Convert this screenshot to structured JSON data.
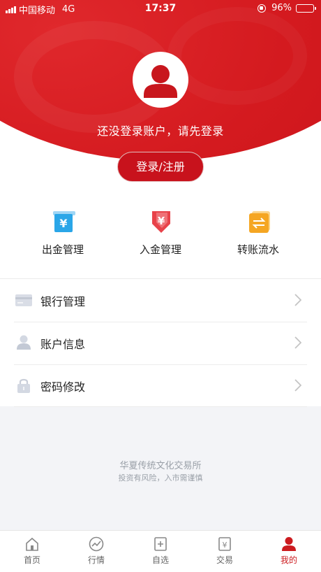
{
  "status_bar": {
    "carrier": "中国移动",
    "network": "4G",
    "time": "17:37",
    "battery_text": "96%",
    "battery_level": 0.96
  },
  "header": {
    "prompt": "还没登录账户，请先登录",
    "login_button": "登录/注册"
  },
  "quick_actions": [
    {
      "label": "出金管理",
      "icon": "withdraw-icon",
      "color": "#2aa6e8"
    },
    {
      "label": "入金管理",
      "icon": "deposit-icon",
      "color": "#e8434a"
    },
    {
      "label": "转账流水",
      "icon": "transfer-icon",
      "color": "#f5a623"
    }
  ],
  "menu": [
    {
      "label": "银行管理",
      "icon": "bank-card-icon"
    },
    {
      "label": "账户信息",
      "icon": "user-icon"
    },
    {
      "label": "密码修改",
      "icon": "lock-icon"
    }
  ],
  "footer": {
    "company": "华夏传统文化交易所",
    "risk": "投资有风险，入市需谨慎"
  },
  "tabbar": [
    {
      "label": "首页",
      "icon": "home-icon"
    },
    {
      "label": "行情",
      "icon": "market-icon"
    },
    {
      "label": "自选",
      "icon": "watchlist-icon"
    },
    {
      "label": "交易",
      "icon": "trade-icon"
    },
    {
      "label": "我的",
      "icon": "profile-icon",
      "active": true
    }
  ],
  "colors": {
    "brand_red": "#d41a1f",
    "active_tab": "#cc1b1f"
  }
}
